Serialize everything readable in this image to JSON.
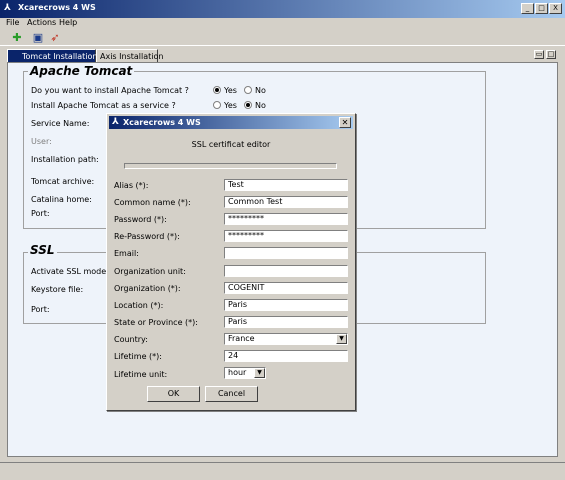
{
  "window": {
    "title": "Xcarecrows 4 WS",
    "minimize": "_",
    "maximize": "□",
    "close": "X"
  },
  "menu": [
    "File",
    "Actions",
    "Help"
  ],
  "toolbar": {
    "icons": [
      "add-icon",
      "save-icon",
      "rocket-icon"
    ]
  },
  "tabs": [
    {
      "label": "Tomcat Installation",
      "active": true
    },
    {
      "label": "Axis Installation",
      "active": false
    }
  ],
  "tomcat": {
    "title": "Apache Tomcat",
    "install_q": "Do you want to install Apache Tomcat ?",
    "service_q": "Install Apache Tomcat as a service ?",
    "yes": "Yes",
    "no": "No",
    "install_selected": "Yes",
    "service_selected": "No",
    "service_name": "Service Name:",
    "user": "User:",
    "install_path": "Installation path:",
    "archive": "Tomcat archive:",
    "catalina": "Catalina home:",
    "port": "Port:"
  },
  "ssl": {
    "title": "SSL",
    "activate": "Activate SSL mode ?",
    "keystore": "Keystore file:",
    "port": "Port:"
  },
  "dialog": {
    "title": "Xcarecrows 4 WS",
    "header": "SSL certificat editor",
    "fields": [
      {
        "label": "Alias (*):",
        "value": "Test"
      },
      {
        "label": "Common name (*):",
        "value": "Common Test"
      },
      {
        "label": "Password (*):",
        "value": "*********"
      },
      {
        "label": "Re-Password (*):",
        "value": "*********"
      },
      {
        "label": "Email:",
        "value": ""
      },
      {
        "label": "Organization unit:",
        "value": ""
      },
      {
        "label": "Organization (*):",
        "value": "COGENIT"
      },
      {
        "label": "Location (*):",
        "value": "Paris"
      },
      {
        "label": "State or Province (*):",
        "value": "Paris"
      },
      {
        "label": "Country:",
        "value": "France"
      },
      {
        "label": "Lifetime (*):",
        "value": "24"
      },
      {
        "label": "Lifetime unit:",
        "value": "hour"
      }
    ],
    "ok": "OK",
    "cancel": "Cancel"
  }
}
